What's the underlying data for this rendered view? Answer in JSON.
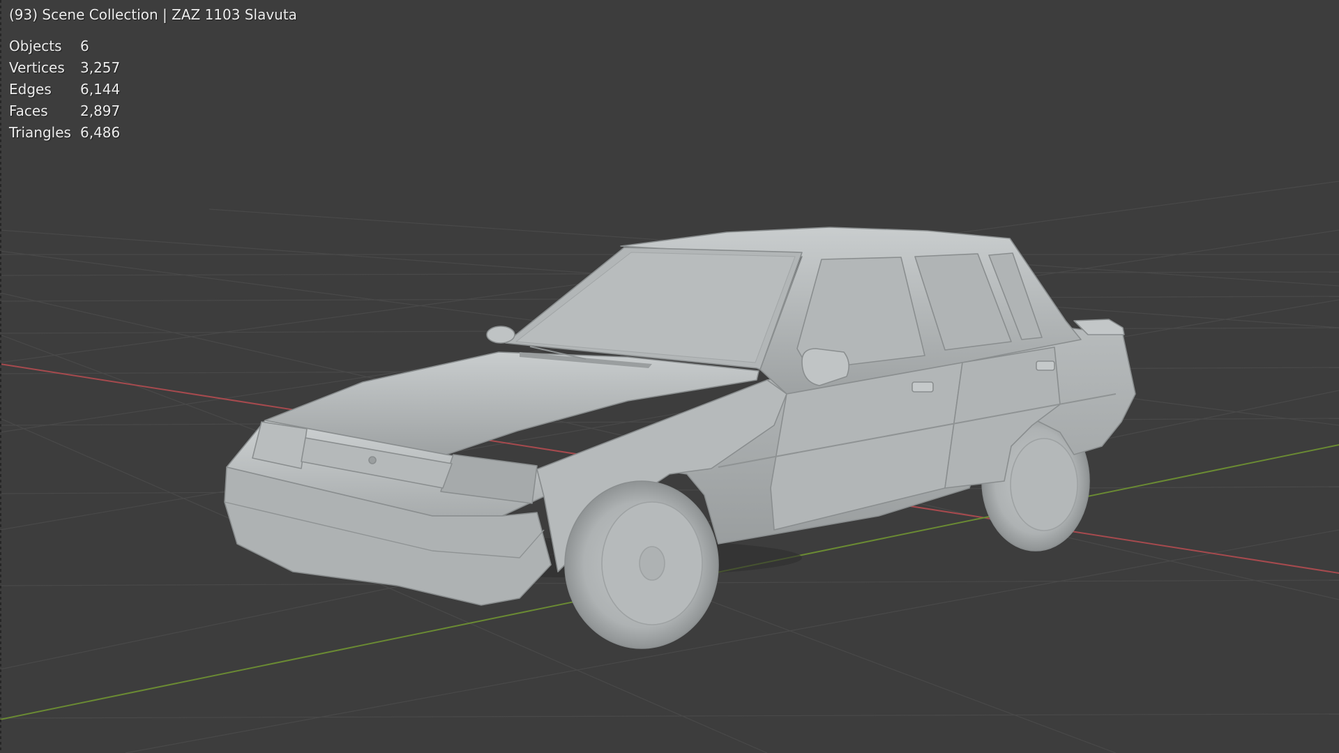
{
  "viewport": {
    "header_text": "(93) Scene Collection | ZAZ 1103 Slavuta",
    "statistics": [
      {
        "label": "Objects",
        "value": "6"
      },
      {
        "label": "Vertices",
        "value": "3,257"
      },
      {
        "label": "Edges",
        "value": "6,144"
      },
      {
        "label": "Faces",
        "value": "2,897"
      },
      {
        "label": "Triangles",
        "value": "6,486"
      }
    ],
    "colors": {
      "background": "#3d3d3d",
      "grid": "#4a4a4a",
      "x_axis": "#a64a4e",
      "y_axis": "#6a8a33",
      "model": "#b9bdbe"
    }
  }
}
